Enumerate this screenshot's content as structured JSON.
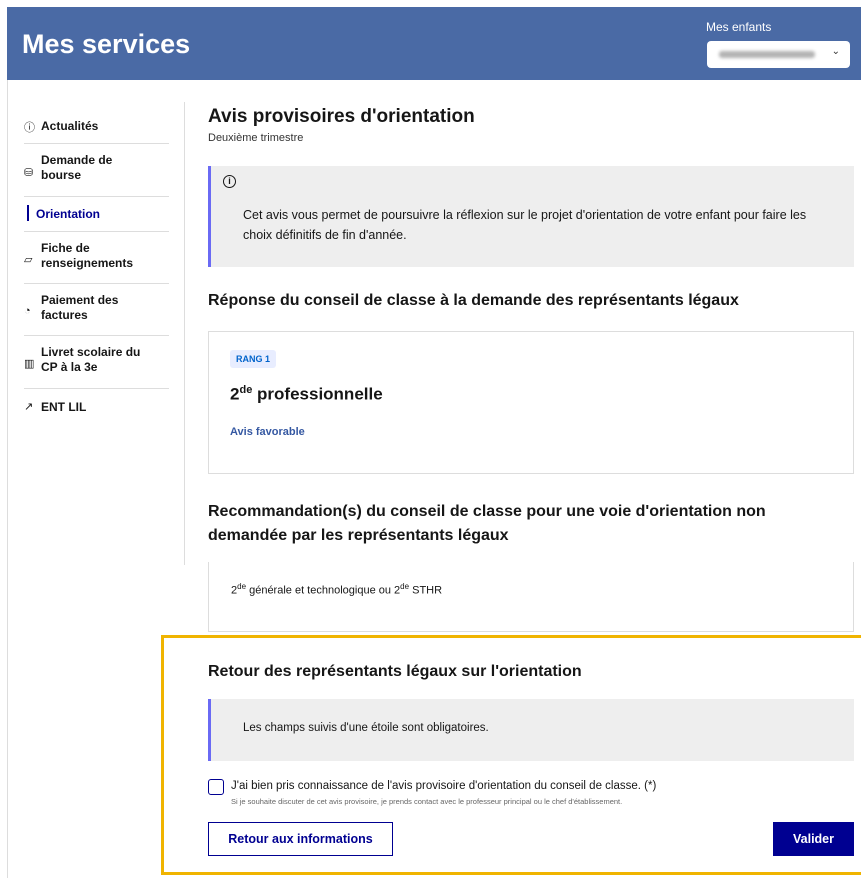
{
  "header": {
    "title": "Mes services",
    "children_label": "Mes enfants",
    "children_select_icon": "chevron-down-icon"
  },
  "sidebar": {
    "items": [
      {
        "label": "Actualités",
        "icon": "info-circle-icon"
      },
      {
        "label": "Demande de bourse",
        "icon": "coins-icon"
      },
      {
        "label": "Orientation",
        "icon": "",
        "active": true
      },
      {
        "label": "Fiche de renseignements",
        "icon": "form-icon"
      },
      {
        "label": "Paiement des factures",
        "icon": "payment-icon"
      },
      {
        "label": "Livret scolaire du CP à la 3e",
        "icon": "book-icon"
      },
      {
        "label": "ENT LIL",
        "icon": "external-link-icon"
      }
    ]
  },
  "main": {
    "title": "Avis provisoires d'orientation",
    "subtitle": "Deuxième trimestre",
    "info_text": "Cet avis vous permet de poursuivre la réflexion sur le projet d'orientation de votre enfant pour faire les choix définitifs de fin d'année.",
    "section1_title": "Réponse du conseil de classe à la demande des représentants légaux",
    "rank_badge": "RANG 1",
    "formation_prefix": "2",
    "formation_sup": "de",
    "formation_name": " professionnelle",
    "avis": "Avis favorable",
    "section2_title": "Recommandation(s) du conseil de classe pour une voie d'orientation non demandée par les représentants légaux",
    "reco_part1": "2",
    "reco_sup1": "de",
    "reco_part2": " générale et technologique ou 2",
    "reco_sup2": "de",
    "reco_part3": " STHR"
  },
  "feedback": {
    "title": "Retour des représentants légaux sur l'orientation",
    "mandatory_note": "Les champs suivis d'une étoile sont obligatoires.",
    "checkbox_label": "J'ai bien pris connaissance de l'avis provisoire d'orientation du conseil de classe. (*)",
    "checkbox_hint": "Si je souhaite discuter de cet avis provisoire, je prends contact avec le professeur principal ou le chef d'établissement.",
    "back_button": "Retour aux informations",
    "submit_button": "Valider"
  },
  "colors": {
    "header_bg": "#4a6aa5",
    "primary": "#000091",
    "accent_border": "#6a6af4",
    "highlight": "#f0b400"
  }
}
